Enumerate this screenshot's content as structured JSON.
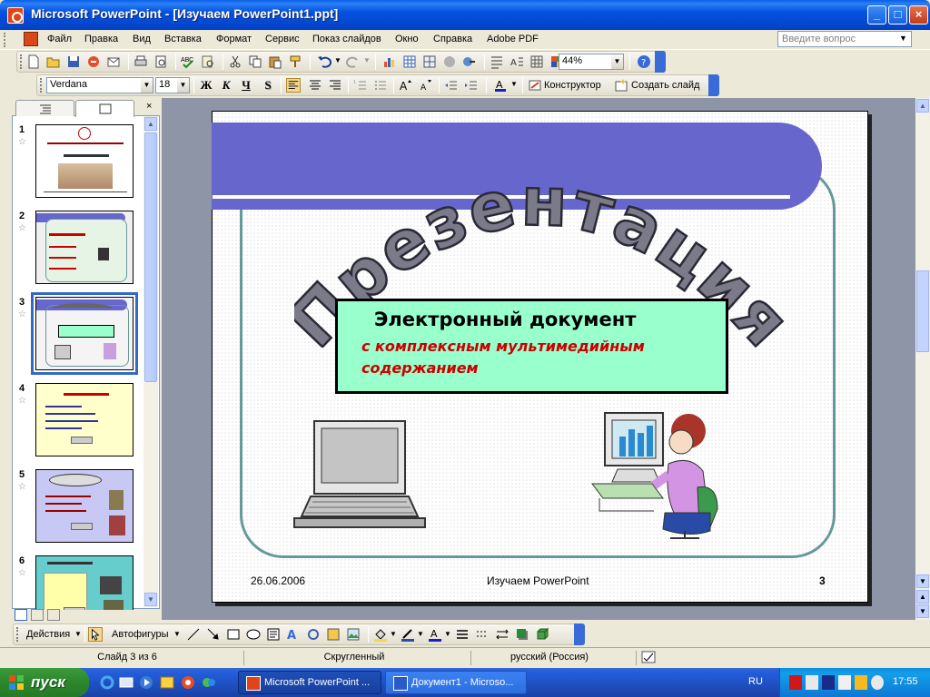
{
  "window": {
    "title": "Microsoft PowerPoint - [Изучаем  PowerPoint1.ppt]"
  },
  "menu": {
    "items": [
      "Файл",
      "Правка",
      "Вид",
      "Вставка",
      "Формат",
      "Сервис",
      "Показ слайдов",
      "Окно",
      "Справка",
      "Adobe PDF"
    ],
    "ask_placeholder": "Введите вопрос"
  },
  "standard_toolbar": {
    "zoom": "44%"
  },
  "format_toolbar": {
    "font": "Verdana",
    "size": "18",
    "bold": "Ж",
    "italic": "К",
    "underline": "Ч",
    "shadow": "S",
    "designer": "Конструктор",
    "new_slide": "Создать слайд"
  },
  "slides_panel": {
    "thumbnails": [
      {
        "num": "1"
      },
      {
        "num": "2"
      },
      {
        "num": "3"
      },
      {
        "num": "4"
      },
      {
        "num": "5"
      },
      {
        "num": "6"
      }
    ],
    "selected": "3"
  },
  "slide": {
    "wordart": "Презентация",
    "box_line1": "Электронный документ",
    "box_line2": "с комплексным мультимедийным",
    "box_line3": "содержанием",
    "date": "26.06.2006",
    "footer": "Изучаем PowerPoint",
    "number": "3"
  },
  "draw_toolbar": {
    "actions": "Действия",
    "autoshapes": "Автофигуры"
  },
  "status": {
    "slide_info": "Слайд 3 из 6",
    "design": "Скругленный",
    "language": "русский (Россия)"
  },
  "taskbar": {
    "start": "пуск",
    "tasks": [
      "Microsoft PowerPoint ...",
      "Документ1 - Microso..."
    ],
    "lang": "RU",
    "time": "17:55"
  },
  "colors": {
    "accent": "#6666cc",
    "box_fill": "#99ffcc",
    "subtitle_red": "#cc0000",
    "frame": "#669999"
  }
}
